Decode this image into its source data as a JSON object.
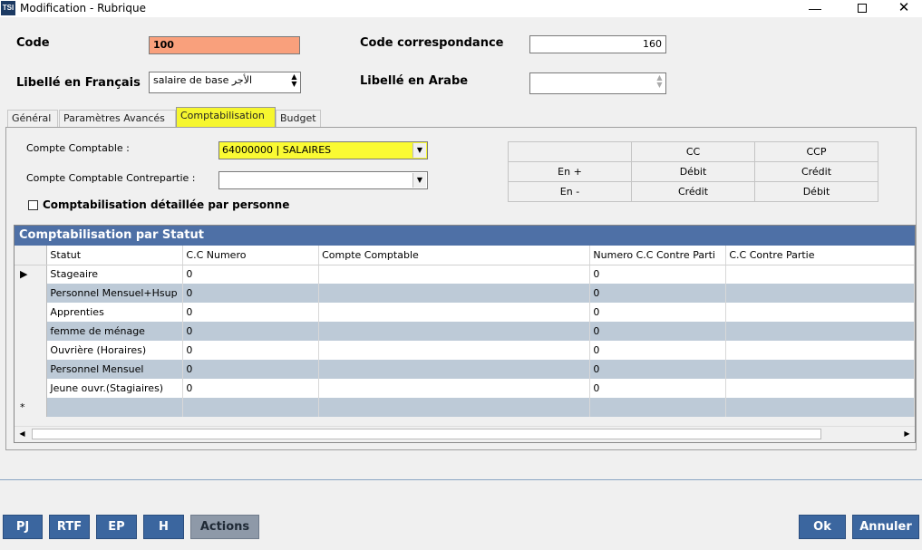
{
  "window": {
    "icon": "TSI",
    "title": "Modification - Rubrique",
    "minimize": "—",
    "close": "✕"
  },
  "header": {
    "code_label": "Code",
    "code_value": "100",
    "code_corresp_label": "Code correspondance",
    "code_corresp_value": "160",
    "libelle_fr_label": "Libellé en Français",
    "libelle_fr_value": "salaire de base الأجر",
    "libelle_ar_label": "Libellé en Arabe",
    "libelle_ar_value": ""
  },
  "tabs": [
    "Général",
    "Paramètres Avancés",
    "Comptabilisation",
    "Budget"
  ],
  "comptabilisation": {
    "compte_label": "Compte Comptable  :",
    "compte_value": "64000000 | SALAIRES",
    "contrepartie_label": "Compte Comptable Contrepartie :",
    "contrepartie_value": "",
    "detail_checkbox_label": "Comptabilisation détaillée par personne"
  },
  "cc_grid": {
    "rows": [
      [
        "",
        "CC",
        "CCP"
      ],
      [
        "En +",
        "Débit",
        "Crédit"
      ],
      [
        "En -",
        "Crédit",
        "Débit"
      ]
    ]
  },
  "statut_grid": {
    "caption": "Comptabilisation par Statut",
    "columns": [
      "Statut",
      "C.C Numero",
      "Compte Comptable",
      "Numero C.C Contre Parti",
      "C.C Contre Partie"
    ],
    "current_row_marker": "▶",
    "new_row_marker": "*",
    "rows": [
      [
        "Stageaire",
        "0",
        "",
        "0",
        ""
      ],
      [
        "Personnel Mensuel+Hsup",
        "0",
        "",
        "0",
        ""
      ],
      [
        "Apprenties",
        "0",
        "",
        "0",
        ""
      ],
      [
        "femme de ménage",
        "0",
        "",
        "0",
        ""
      ],
      [
        "Ouvrière (Horaires)",
        "0",
        "",
        "0",
        ""
      ],
      [
        "Personnel Mensuel",
        "0",
        "",
        "0",
        ""
      ],
      [
        "Jeune ouvr.(Stagiaires)",
        "0",
        "",
        "0",
        ""
      ]
    ]
  },
  "buttons": {
    "pj": "PJ",
    "rtf": "RTF",
    "ep": "EP",
    "h": "H",
    "actions": "Actions",
    "ok": "Ok",
    "annuler": "Annuler"
  },
  "colors": {
    "code_field_bg": "#f9a07c",
    "highlight": "#f6f62f",
    "grid_caption": "#4e70a6",
    "button_blue": "#3b669f",
    "alt_row": "#bdcad7"
  }
}
